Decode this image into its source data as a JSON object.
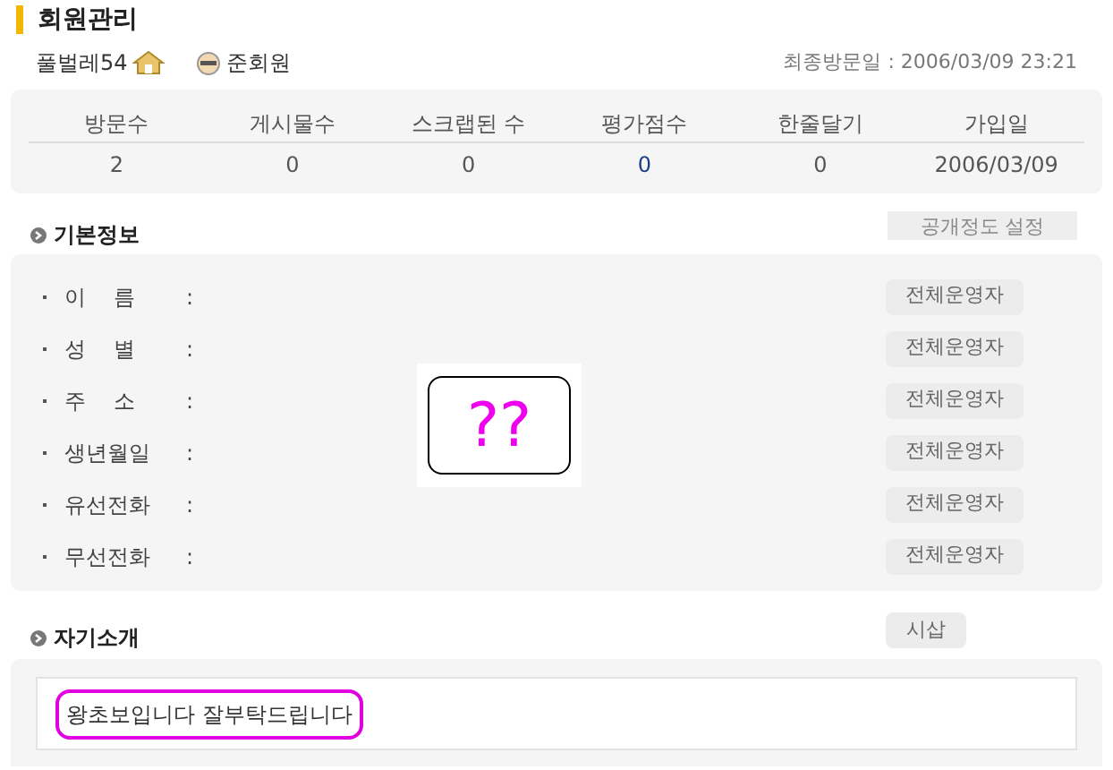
{
  "title": "회원관리",
  "user": {
    "nickname": "풀벌레54",
    "grade": "준회원",
    "last_visit": "최종방문일 : 2006/03/09 23:21"
  },
  "stats": {
    "columns": [
      "방문수",
      "게시물수",
      "스크랩된 수",
      "평가점수",
      "한줄달기",
      "가입일"
    ],
    "values": [
      {
        "text": "2",
        "highlight": false
      },
      {
        "text": "0",
        "highlight": false
      },
      {
        "text": "0",
        "highlight": false
      },
      {
        "text": "0",
        "highlight": true
      },
      {
        "text": "0",
        "highlight": false
      },
      {
        "text": "2006/03/09",
        "highlight": false
      }
    ]
  },
  "basic_info": {
    "heading": "기본정보",
    "settings_button": "공개정도 설정",
    "fields": [
      {
        "label": "이    름",
        "separator": ":",
        "visibility": "전체운영자"
      },
      {
        "label": "성    별",
        "separator": ":",
        "visibility": "전체운영자"
      },
      {
        "label": "주    소",
        "separator": ":",
        "visibility": "전체운영자"
      },
      {
        "label": "생년월일",
        "separator": ":",
        "visibility": "전체운영자"
      },
      {
        "label": "유선전화",
        "separator": ":",
        "visibility": "전체운영자"
      },
      {
        "label": "무선전화",
        "separator": ":",
        "visibility": "전체운영자"
      }
    ]
  },
  "introduction": {
    "heading": "자기소개",
    "button": "시삽",
    "text": "왕초보입니다 잘부탁드립니다"
  },
  "annotations": [
    {
      "kind": "question-box",
      "text": "??"
    },
    {
      "kind": "highlight-ring"
    }
  ]
}
